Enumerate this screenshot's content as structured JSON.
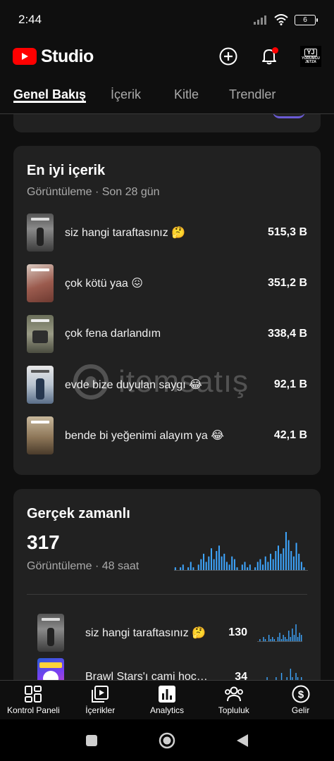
{
  "status_bar": {
    "time": "2:44",
    "battery": "6"
  },
  "header": {
    "logo_text": "Studio",
    "avatar_line1": "YJ",
    "avatar_line2": "YORUMCU",
    "avatar_line3": "JETZA"
  },
  "tabs": [
    {
      "label": "Genel Bakış",
      "active": true
    },
    {
      "label": "İçerik"
    },
    {
      "label": "Kitle"
    },
    {
      "label": "Trendler"
    }
  ],
  "top_content": {
    "title": "En iyi içerik",
    "subtitle": "Görüntüleme · Son 28 gün",
    "items": [
      {
        "title": "siz hangi taraftasınız 🤔",
        "value": "515,3 B"
      },
      {
        "title": "çok kötü yaa 😖",
        "value": "351,2 B"
      },
      {
        "title": "çok fena darlandım",
        "value": "338,4 B"
      },
      {
        "title": "evde bize duyulan saygı 😂",
        "value": "92,1 B"
      },
      {
        "title": "bende bi yeğenimi alayım ya 😂",
        "value": "42,1 B"
      }
    ]
  },
  "realtime": {
    "title": "Gerçek zamanlı",
    "views": "317",
    "subtitle": "Görüntüleme · 48 saat",
    "accent_color": "#3ea6ff",
    "bars": [
      1,
      0,
      1,
      2,
      0,
      1,
      3,
      1,
      0,
      2,
      4,
      6,
      3,
      5,
      8,
      4,
      7,
      9,
      5,
      6,
      3,
      2,
      5,
      4,
      1,
      0,
      2,
      3,
      1,
      2,
      0,
      1,
      3,
      4,
      2,
      5,
      3,
      6,
      4,
      7,
      9,
      6,
      8,
      14,
      11,
      7,
      5,
      10,
      6,
      3,
      1,
      0
    ],
    "items": [
      {
        "title": "siz hangi taraftasınız 🤔",
        "value": "130",
        "bars": [
          0,
          1,
          0,
          2,
          1,
          0,
          3,
          1,
          2,
          1,
          0,
          2,
          4,
          1,
          3,
          2,
          1,
          5,
          2,
          6,
          3,
          8,
          2,
          4,
          3
        ]
      },
      {
        "title": "Brawl Stars'ı cami hocası",
        "value": "34",
        "bars": [
          0,
          1,
          0,
          0,
          1,
          2,
          0,
          1,
          1,
          0,
          2,
          1,
          0,
          3,
          1,
          0,
          2,
          1,
          4,
          2,
          1,
          3,
          2,
          1,
          2
        ]
      }
    ]
  },
  "watermark": {
    "text": "itemsatış"
  },
  "bottom_nav": [
    {
      "label": "Kontrol Paneli",
      "icon": "dashboard-icon"
    },
    {
      "label": "İçerikler",
      "icon": "content-icon"
    },
    {
      "label": "Analytics",
      "icon": "analytics-icon"
    },
    {
      "label": "Topluluk",
      "icon": "community-icon"
    },
    {
      "label": "Gelir",
      "icon": "earn-icon"
    }
  ]
}
